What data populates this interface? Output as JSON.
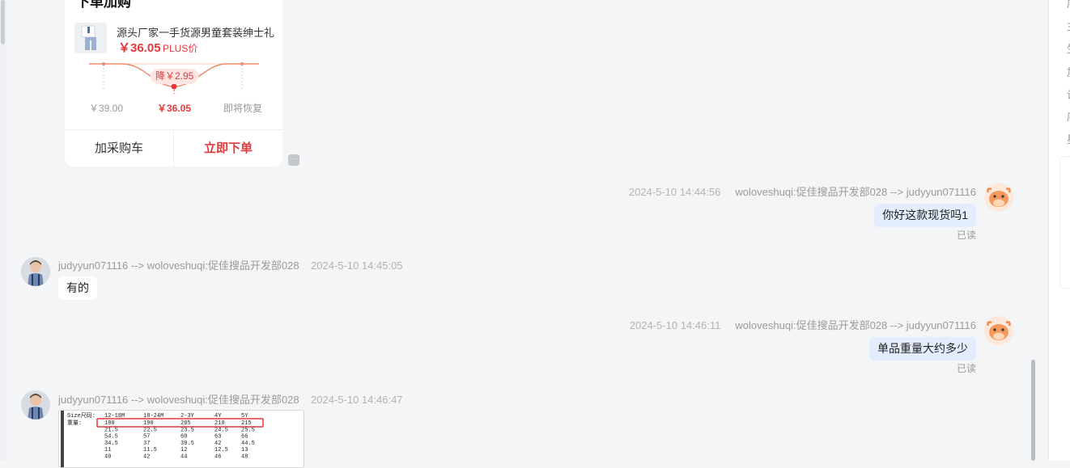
{
  "product_card": {
    "title": "下单加购",
    "name": "源头厂家一手货源男童套装绅士礼",
    "price": "￥36.05",
    "price_tag": "PLUS价",
    "drop_badge": "降￥2.95",
    "label_before": "￥39.00",
    "label_now": "￥36.05",
    "label_after": "即将恢复",
    "add_to_cart": "加采购车",
    "order_now": "立即下单"
  },
  "messages": [
    {
      "side": "right",
      "time": "2024-5-10 14:44:56",
      "route": "woloveshuqi:促佳搜品开发部028 --> judyyun071116",
      "text": "你好这款现货吗1",
      "status": "已读"
    },
    {
      "side": "left",
      "route": "judyyun071116 --> woloveshuqi:促佳搜品开发部028",
      "time": "2024-5-10 14:45:05",
      "text": "有的"
    },
    {
      "side": "right",
      "time": "2024-5-10 14:46:11",
      "route": "woloveshuqi:促佳搜品开发部028 --> judyyun071116",
      "text": "单品重量大约多少",
      "status": "已读"
    },
    {
      "side": "left",
      "route": "judyyun071116 --> woloveshuqi:促佳搜品开发部028",
      "time": "2024-5-10 14:46:47",
      "image": {
        "header": [
          "Size尺码:",
          "12-18M",
          "18-24M",
          "2-3Y",
          "4Y",
          "5Y"
        ],
        "rows": [
          [
            "重量:",
            "180",
            "190",
            "205",
            "210",
            "215"
          ],
          [
            "",
            "21.5",
            "22.5",
            "23.5",
            "24.5",
            "25.5"
          ],
          [
            "",
            "54.5",
            "57",
            "60",
            "63",
            "66"
          ],
          [
            "",
            "34.5",
            "37",
            "39.5",
            "42",
            "44.5"
          ],
          [
            "",
            "11",
            "11.5",
            "12",
            "12.5",
            "13"
          ],
          [
            "",
            "40",
            "42",
            "44",
            "46",
            "48"
          ]
        ]
      }
    }
  ],
  "right_panel": {
    "glyphs": [
      "店",
      "主",
      "生",
      "加",
      "设",
      "店",
      "星"
    ]
  },
  "colors": {
    "accent_red": "#e4393c",
    "bubble_blue": "#e4edfd",
    "background": "#f4f5f7"
  }
}
